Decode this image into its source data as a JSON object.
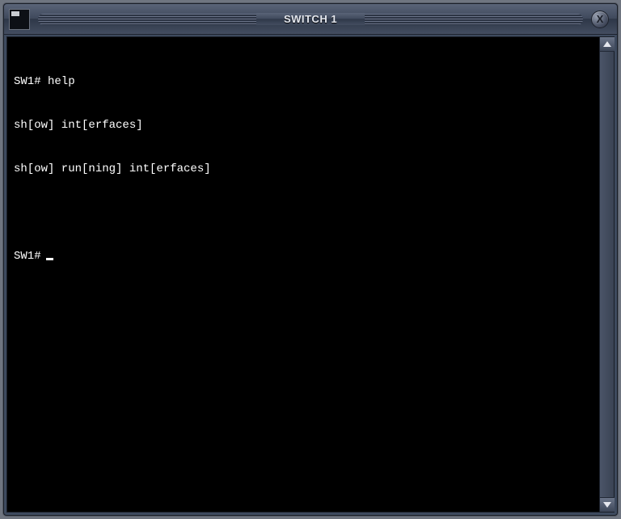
{
  "window": {
    "title": "SWITCH 1",
    "close_label": "X"
  },
  "terminal": {
    "lines": [
      "SW1# help",
      "sh[ow] int[erfaces]",
      "sh[ow] run[ning] int[erfaces]",
      "",
      "SW1#"
    ],
    "prompt": "SW1#"
  }
}
